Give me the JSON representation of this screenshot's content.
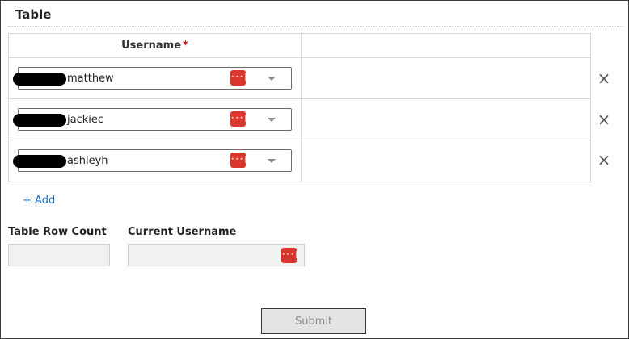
{
  "section": {
    "title": "Table"
  },
  "table": {
    "column_header": "Username",
    "required_mark": "*",
    "rows": [
      {
        "value": "matthew",
        "remove_icon": "×"
      },
      {
        "value": "jackiec",
        "remove_icon": "×"
      },
      {
        "value": "ashleyh",
        "remove_icon": "×"
      }
    ],
    "password_manager_icon": "···|",
    "add_label": "+ Add"
  },
  "fields": {
    "row_count_label": "Table Row Count",
    "row_count_value": "",
    "current_username_label": "Current Username",
    "current_username_value": ""
  },
  "actions": {
    "submit_label": "Submit"
  },
  "colors": {
    "accent_link": "#1a6fc4",
    "required": "#c0121a",
    "password_manager_icon": "#d9372d"
  }
}
